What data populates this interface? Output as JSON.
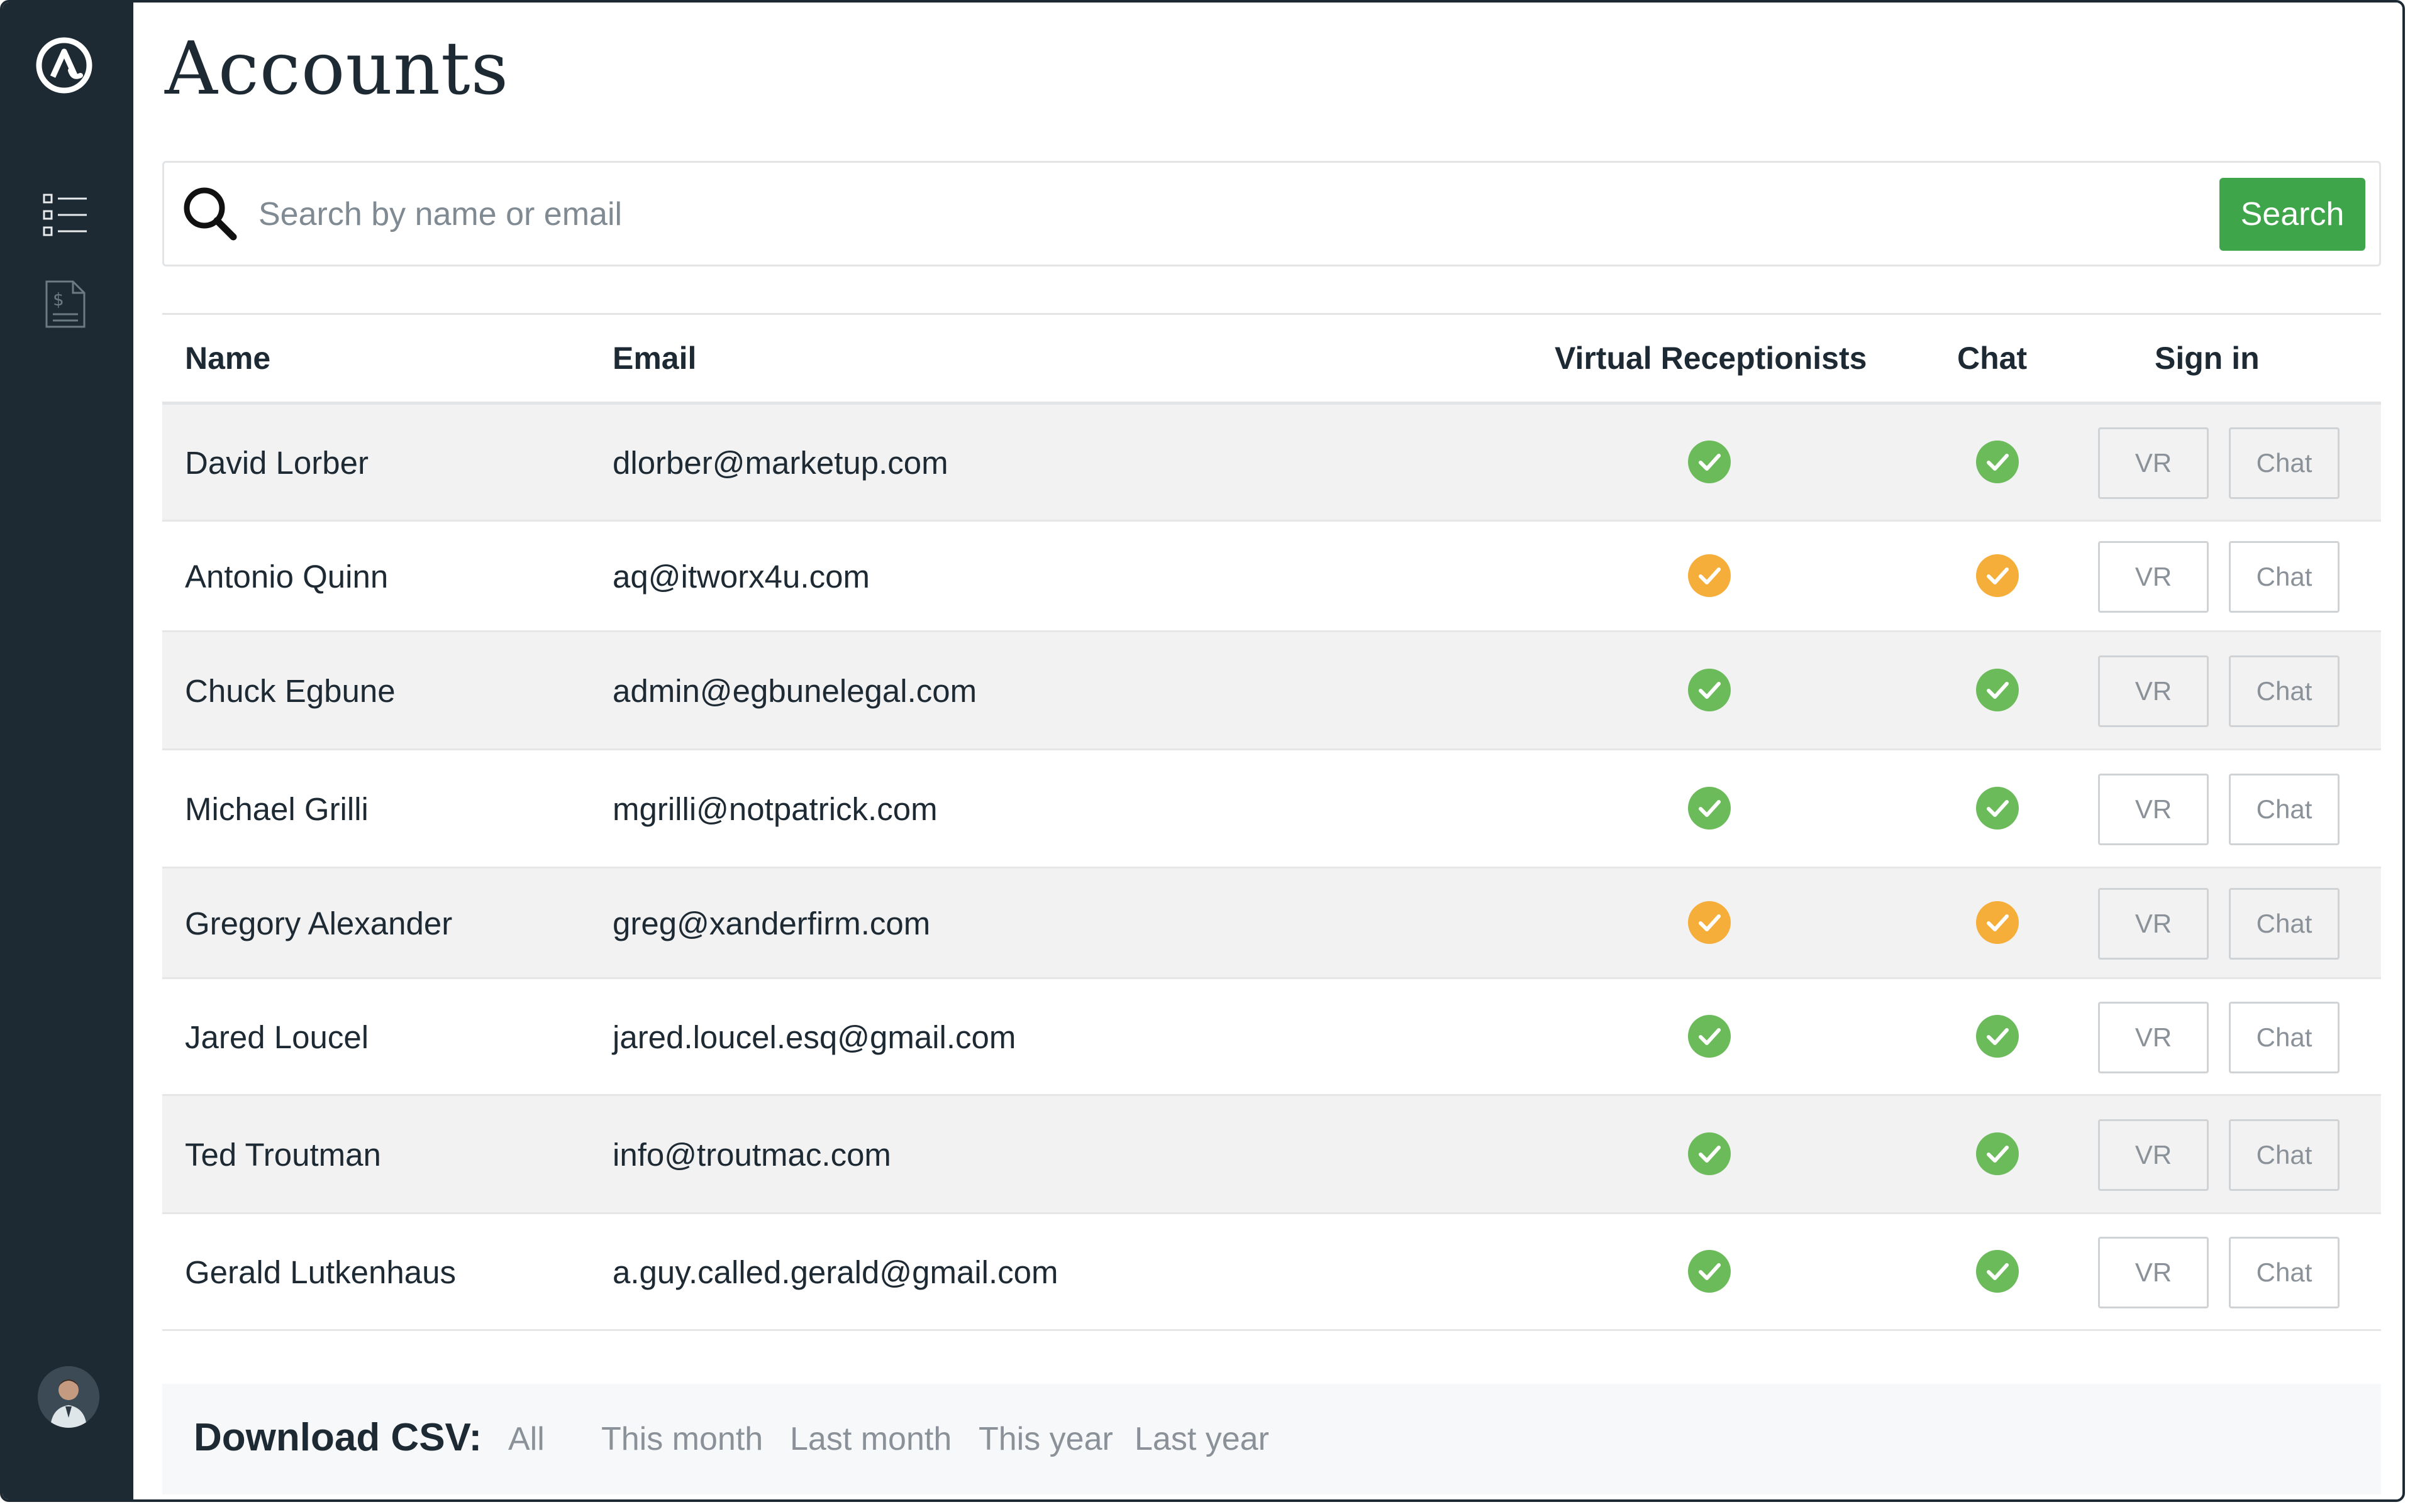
{
  "page": {
    "title": "Accounts"
  },
  "sidebar": {
    "logo_icon": "at-sign-logo-icon",
    "items": [
      {
        "icon": "list-icon"
      },
      {
        "icon": "invoice-dollar-icon"
      }
    ],
    "avatar_icon": "user-avatar"
  },
  "search": {
    "placeholder": "Search by name or email",
    "value": "",
    "button_label": "Search",
    "button_color": "#3fa54a"
  },
  "table": {
    "headers": {
      "name": "Name",
      "email": "Email",
      "vr": "Virtual Receptionists",
      "chat": "Chat",
      "signin": "Sign in"
    },
    "signin_buttons": {
      "vr": "VR",
      "chat": "Chat"
    },
    "rows": [
      {
        "name": "David Lorber",
        "email": "dlorber@marketup.com",
        "vr_status": "green",
        "chat_status": "green"
      },
      {
        "name": "Antonio Quinn",
        "email": "aq@itworx4u.com",
        "vr_status": "orange",
        "chat_status": "orange"
      },
      {
        "name": "Chuck Egbune",
        "email": "admin@egbunelegal.com",
        "vr_status": "green",
        "chat_status": "green"
      },
      {
        "name": "Michael Grilli",
        "email": "mgrilli@notpatrick.com",
        "vr_status": "green",
        "chat_status": "green"
      },
      {
        "name": "Gregory Alexander",
        "email": "greg@xanderfirm.com",
        "vr_status": "orange",
        "chat_status": "orange"
      },
      {
        "name": "Jared Loucel",
        "email": "jared.loucel.esq@gmail.com",
        "vr_status": "green",
        "chat_status": "green"
      },
      {
        "name": "Ted Troutman",
        "email": "info@troutmac.com",
        "vr_status": "green",
        "chat_status": "green"
      },
      {
        "name": "Gerald Lutkenhaus",
        "email": "a.guy.called.gerald@gmail.com",
        "vr_status": "green",
        "chat_status": "green"
      }
    ],
    "status_colors": {
      "green": "#6cbb5b",
      "orange": "#f5ae3a"
    }
  },
  "csv": {
    "label": "Download CSV:",
    "links": [
      "All",
      "This month",
      "Last month",
      "This year",
      "Last year"
    ]
  },
  "colors": {
    "sidebar_bg": "#1e2a33",
    "row_alt_bg": "#f2f2f2"
  }
}
